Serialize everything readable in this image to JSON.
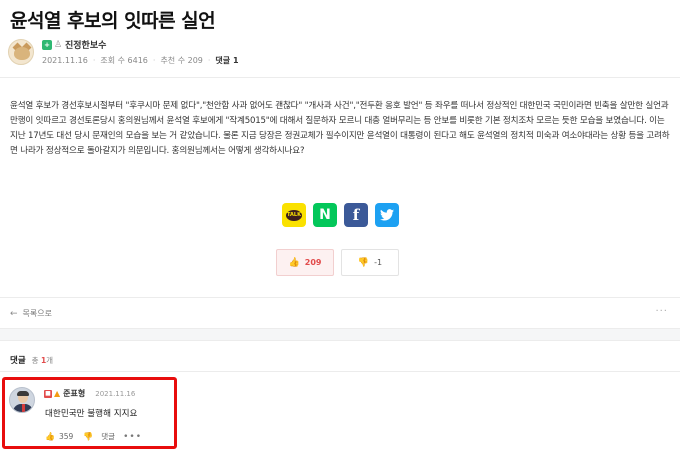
{
  "post": {
    "title": "윤석열 후보의 잇따른 실언",
    "author": {
      "name": "진정한보수",
      "avatar_icon": "cat-avatar"
    },
    "date": "2021.11.16",
    "views": "조회 수 6416",
    "recommend": "추천 수 209",
    "comment_label": "댓글",
    "comment_count": "1",
    "body": "윤석열 후보가 경선후보시절부터 \"후쿠시마 문제 없다\",\"천안함 사과 없어도 괜찮다\" \"개사과 사건\",\"전두환 옹호 발언\" 등 좌우를 떠나서 정상적인 대한민국 국민이라면 빈축을 살만한 실언과 만행이 잇따르고 경선토론당시 홍의원님께서 윤석열 후보에게 \"작계5015\"에 대해서 질문하자 모르니 대충 얼버무리는 등 안보를 비롯한 기본 정치조차 모르는 듯한 모습을 보였습니다. 이는 지난 17년도 대선 당시 문재인의 모습을 보는 거 같았습니다. 물론 지금 당장은 정권교체가 필수이지만 윤석열이 대통령이 된다고 해도 윤석열의 정치적 미숙과 여소야대라는 상황 등을 고려하면 나라가 정상적으로 돌아갈지가 의문입니다.  홍의원님께서는 어떻게 생각하시나요?"
  },
  "share": {
    "kakao_text": "TALK",
    "naver_text": "N",
    "facebook_text": "f",
    "twitter_icon": "bird-icon"
  },
  "votes": {
    "up": "209",
    "down": "-1"
  },
  "nav": {
    "back_label": "목록으로",
    "more": "···"
  },
  "comments": {
    "title": "댓글",
    "count_prefix": "총",
    "count": "1",
    "count_suffix": "개",
    "items": [
      {
        "author": "준표형",
        "date": "2021.11.16",
        "text": "대한민국만 불행해 지지요",
        "likes": "359",
        "reply_label": "댓글",
        "more": "•••"
      }
    ]
  },
  "colors": {
    "highlight": "#e80d0d",
    "accent": "#e24b4b"
  }
}
